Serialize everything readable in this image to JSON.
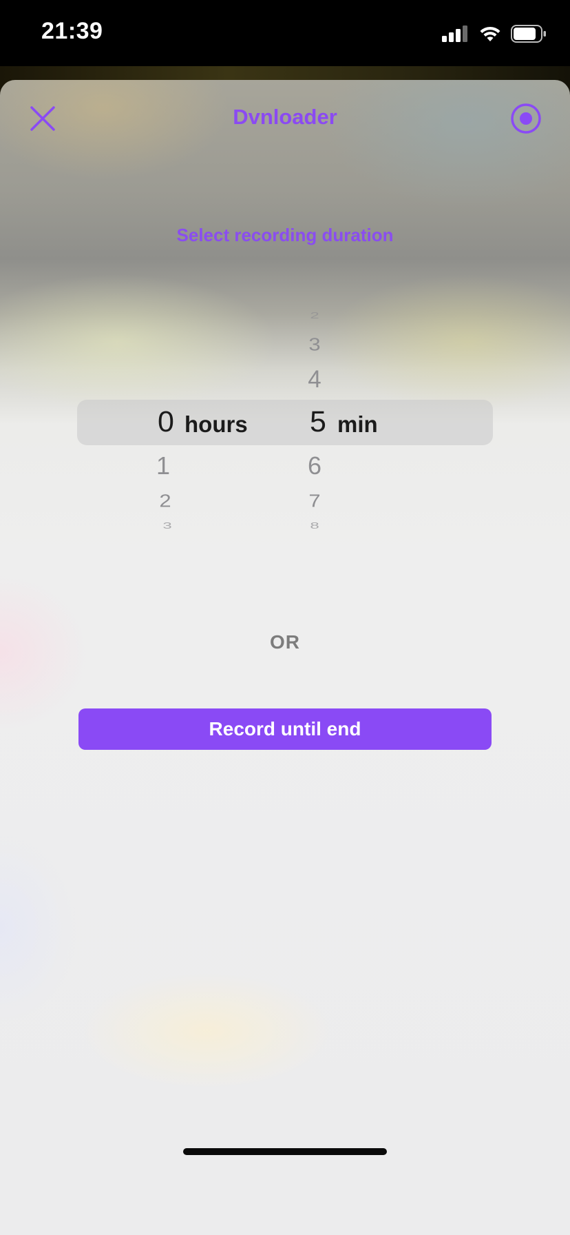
{
  "status_bar": {
    "time": "21:39"
  },
  "header": {
    "title": "Dvnloader"
  },
  "picker": {
    "prompt": "Select recording duration",
    "hours": {
      "above": [],
      "selected": "0",
      "below": [
        "1",
        "2",
        "3"
      ],
      "unit": "hours"
    },
    "minutes": {
      "above": [
        "2",
        "3",
        "4"
      ],
      "selected": "5",
      "below": [
        "6",
        "7",
        "8"
      ],
      "unit": "min"
    }
  },
  "divider_text": "OR",
  "record_until_end_label": "Record until end",
  "colors": {
    "accent": "#8a4af5",
    "background": "#ececec"
  }
}
